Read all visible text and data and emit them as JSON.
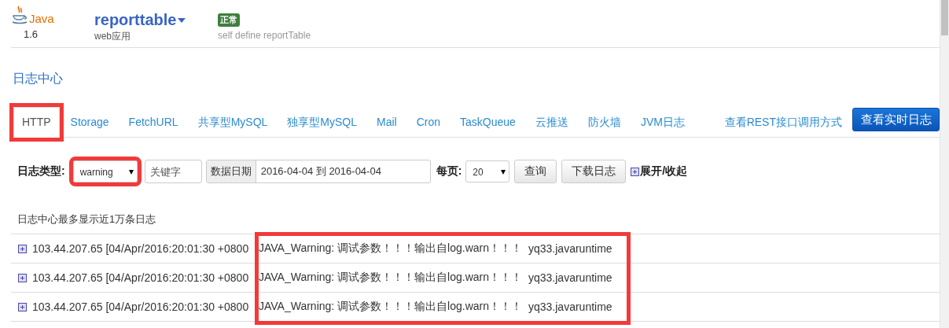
{
  "app": {
    "platform": "Java",
    "version": "1.6",
    "name": "reporttable",
    "type": "web应用",
    "status": "正常",
    "description": "self define reportTable"
  },
  "section_title": "日志中心",
  "tabs": [
    {
      "label": "HTTP",
      "selected": true,
      "annotated": true
    },
    {
      "label": "Storage",
      "selected": false,
      "annotated": false
    },
    {
      "label": "FetchURL",
      "selected": false,
      "annotated": false
    },
    {
      "label": "共享型MySQL",
      "selected": false,
      "annotated": false
    },
    {
      "label": "独享型MySQL",
      "selected": false,
      "annotated": false
    },
    {
      "label": "Mail",
      "selected": false,
      "annotated": false
    },
    {
      "label": "Cron",
      "selected": false,
      "annotated": false
    },
    {
      "label": "TaskQueue",
      "selected": false,
      "annotated": false
    },
    {
      "label": "云推送",
      "selected": false,
      "annotated": false
    },
    {
      "label": "防火墙",
      "selected": false,
      "annotated": false
    },
    {
      "label": "JVM日志",
      "selected": false,
      "annotated": false
    }
  ],
  "api_link": "查看REST接口调用方式",
  "realtime_button": "查看实时日志",
  "filters": {
    "type_label": "日志类型:",
    "type_value": "warning",
    "type_annotated": true,
    "keyword_placeholder": "关键字",
    "date_label": "数据日期",
    "date_value": "2016-04-04 到 2016-04-04",
    "per_page_label": "每页:",
    "per_page_value": "20",
    "query_button": "查询",
    "download_button": "下载日志",
    "toggle": "展开/收起"
  },
  "note": "日志中心最多显示近1万条日志",
  "messages_annotated": true,
  "logs": [
    {
      "source": "103.44.207.65 [04/Apr/2016:20:01:30 +0800",
      "message": "JAVA_Warning: 调试参数！！！输出自log.warn！！！",
      "app": "yq33.javaruntime"
    },
    {
      "source": "103.44.207.65 [04/Apr/2016:20:01:30 +0800",
      "message": "JAVA_Warning: 调试参数！！！输出自log.warn！！！",
      "app": "yq33.javaruntime"
    },
    {
      "source": "103.44.207.65 [04/Apr/2016:20:01:30 +0800",
      "message": "JAVA_Warning: 调试参数！！！输出自log.warn！！！",
      "app": "yq33.javaruntime"
    }
  ]
}
